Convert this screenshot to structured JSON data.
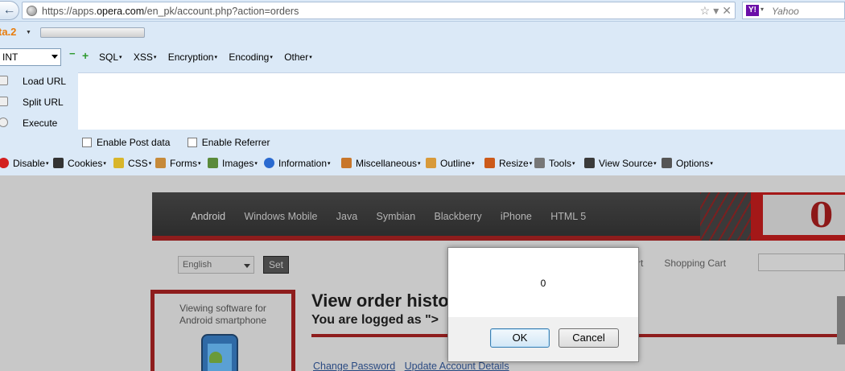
{
  "address_bar": {
    "url_prefix": "https://apps.",
    "url_domain": "opera.com",
    "url_suffix": "/en_pk/account.php?action=orders",
    "search_placeholder": "Yahoo",
    "search_engine_icon": "Y!",
    "back_glyph": "←",
    "star_glyph": "☆",
    "dropdown_glyph": "▾",
    "close_glyph": "✕"
  },
  "hackbar": {
    "logo": "ta.2",
    "type_select": "INT",
    "menus": [
      "SQL",
      "XSS",
      "Encryption",
      "Encoding",
      "Other"
    ],
    "actions": [
      "Load URL",
      "Split URL",
      "Execute"
    ],
    "checkboxes": [
      "Enable Post data",
      "Enable Referrer"
    ]
  },
  "webdev_toolbar": {
    "items": [
      {
        "label": "Disable",
        "icon": "disable-icon",
        "color": "#d32020"
      },
      {
        "label": "Cookies",
        "icon": "cookie-icon",
        "color": "#333333"
      },
      {
        "label": "CSS",
        "icon": "css-icon",
        "color": "#d8b52a"
      },
      {
        "label": "Forms",
        "icon": "forms-icon",
        "color": "#c68a3a"
      },
      {
        "label": "Images",
        "icon": "images-icon",
        "color": "#5a8a3a"
      },
      {
        "label": "Information",
        "icon": "info-icon",
        "color": "#2a6ad0"
      },
      {
        "label": "Miscellaneous",
        "icon": "misc-icon",
        "color": "#c8762a"
      },
      {
        "label": "Outline",
        "icon": "outline-icon",
        "color": "#d89a3a"
      },
      {
        "label": "Resize",
        "icon": "resize-icon",
        "color": "#cc5a1a"
      },
      {
        "label": "Tools",
        "icon": "tools-icon",
        "color": "#777777"
      },
      {
        "label": "View Source",
        "icon": "view-source-icon",
        "color": "#3a3a3a"
      },
      {
        "label": "Options",
        "icon": "options-icon",
        "color": "#555555"
      }
    ]
  },
  "page": {
    "nav_items": [
      "Android",
      "Windows Mobile",
      "Java",
      "Symbian",
      "Blackberry",
      "iPhone",
      "HTML 5"
    ],
    "brand_logo": "0",
    "language_select": "English",
    "set_button": "Set",
    "cart_links": [
      "rt",
      "Shopping Cart"
    ],
    "sidebar_text_line1": "Viewing software for",
    "sidebar_text_line2": "Android smartphone",
    "content_title": "View order histo",
    "content_subtitle": "You are logged as \">",
    "account_links": [
      "Change Password",
      "Update Account Details"
    ]
  },
  "dialog": {
    "message": "0",
    "ok_label": "OK",
    "cancel_label": "Cancel"
  }
}
